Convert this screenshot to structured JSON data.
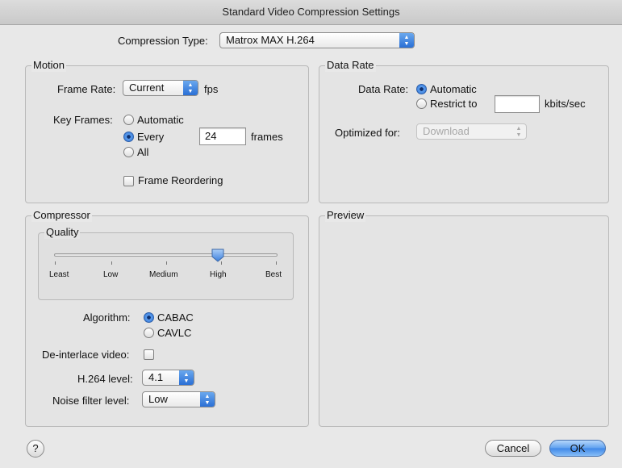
{
  "window": {
    "title": "Standard Video Compression Settings"
  },
  "compression_type": {
    "label": "Compression Type:",
    "value": "Matrox MAX H.264"
  },
  "motion": {
    "group_label": "Motion",
    "frame_rate_label": "Frame Rate:",
    "frame_rate_value": "Current",
    "fps_unit": "fps",
    "key_frames_label": "Key Frames:",
    "key_frames_options": [
      "Automatic",
      "Every",
      "All"
    ],
    "key_frames_selected": "Every",
    "key_frames_every_value": "24",
    "frames_unit": "frames",
    "frame_reordering_label": "Frame Reordering",
    "frame_reordering_checked": false
  },
  "data_rate": {
    "group_label": "Data Rate",
    "data_rate_label": "Data Rate:",
    "options": [
      "Automatic",
      "Restrict to"
    ],
    "selected": "Automatic",
    "restrict_value": "",
    "unit": "kbits/sec",
    "optimized_label": "Optimized for:",
    "optimized_value": "Download"
  },
  "compressor": {
    "group_label": "Compressor",
    "quality": {
      "group_label": "Quality",
      "ticks": [
        "Least",
        "Low",
        "Medium",
        "High",
        "Best"
      ],
      "selected": "High",
      "value_fraction": 0.75
    },
    "algorithm_label": "Algorithm:",
    "algorithm_options": [
      "CABAC",
      "CAVLC"
    ],
    "algorithm_selected": "CABAC",
    "deinterlace_label": "De-interlace video:",
    "deinterlace_checked": false,
    "h264_level_label": "H.264 level:",
    "h264_level_value": "4.1",
    "noise_filter_label": "Noise filter level:",
    "noise_filter_value": "Low"
  },
  "preview": {
    "group_label": "Preview"
  },
  "buttons": {
    "help": "?",
    "cancel": "Cancel",
    "ok": "OK"
  },
  "colors": {
    "accent": "#3f88e8",
    "background": "#e8e8e8"
  }
}
